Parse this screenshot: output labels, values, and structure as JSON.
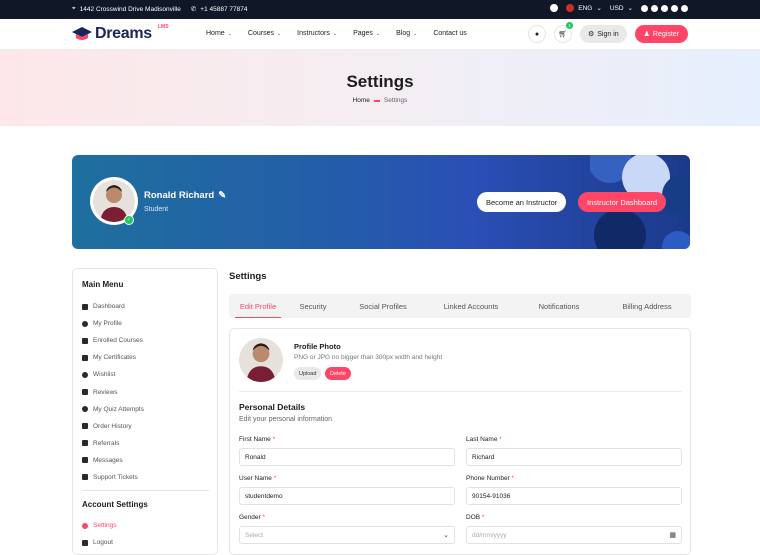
{
  "topbar": {
    "address": "1442 Crosswind Drive Madisonville",
    "phone": "+1 45887 77874",
    "language": "ENG",
    "currency": "USD"
  },
  "header": {
    "logo_text": "Dreams",
    "logo_suffix": "LMS",
    "nav": [
      "Home",
      "Courses",
      "Instructors",
      "Pages",
      "Blog",
      "Contact us"
    ],
    "cart_count": "1",
    "signin_label": "Sign in",
    "register_label": "Register"
  },
  "banner": {
    "title": "Settings",
    "crumb_home": "Home",
    "crumb_current": "Settings"
  },
  "hero": {
    "name": "Ronald Richard",
    "role": "Student",
    "become_label": "Become an Instructor",
    "dashboard_label": "Instructor Dashboard"
  },
  "sidebar": {
    "main_menu_title": "Main Menu",
    "items": [
      {
        "label": "Dashboard",
        "icon": "grid-icon"
      },
      {
        "label": "My Profile",
        "icon": "user-icon"
      },
      {
        "label": "Enrolled Courses",
        "icon": "book-icon"
      },
      {
        "label": "My Certificates",
        "icon": "certificate-icon"
      },
      {
        "label": "Wishlist",
        "icon": "heart-icon"
      },
      {
        "label": "Reviews",
        "icon": "star-icon"
      },
      {
        "label": "My Quiz Attempts",
        "icon": "quiz-icon"
      },
      {
        "label": "Order History",
        "icon": "receipt-icon"
      },
      {
        "label": "Referrals",
        "icon": "share-icon"
      },
      {
        "label": "Messages",
        "icon": "message-icon"
      },
      {
        "label": "Support Tickets",
        "icon": "ticket-icon"
      }
    ],
    "account_title": "Account Settings",
    "account_items": [
      {
        "label": "Settings",
        "icon": "gear-icon"
      },
      {
        "label": "Logout",
        "icon": "logout-icon"
      }
    ]
  },
  "main": {
    "title": "Settings",
    "tabs": [
      "Edit Profile",
      "Security",
      "Social Profiles",
      "Linked Accounts",
      "Notifications",
      "Billing Address"
    ],
    "photo_title": "Profile Photo",
    "photo_hint": "PNG or JPG no bigger than 300px width and height",
    "upload_label": "Upload",
    "delete_label": "Delete",
    "section_title": "Personal Details",
    "section_sub": "Edit your personal information",
    "fields": {
      "first_name_label": "First Name",
      "first_name_value": "Ronald",
      "last_name_label": "Last Name",
      "last_name_value": "Richard",
      "user_name_label": "User Name",
      "user_name_value": "studentdemo",
      "phone_label": "Phone Number",
      "phone_value": "90154-91036",
      "gender_label": "Gender",
      "gender_placeholder": "Select",
      "dob_label": "DOB",
      "dob_placeholder": "dd/mm/yyyy",
      "required_mark": "*"
    }
  },
  "colors": {
    "accent": "#ff4667",
    "topbar": "#101828",
    "hero": "#235ea8",
    "success": "#22c55e"
  }
}
